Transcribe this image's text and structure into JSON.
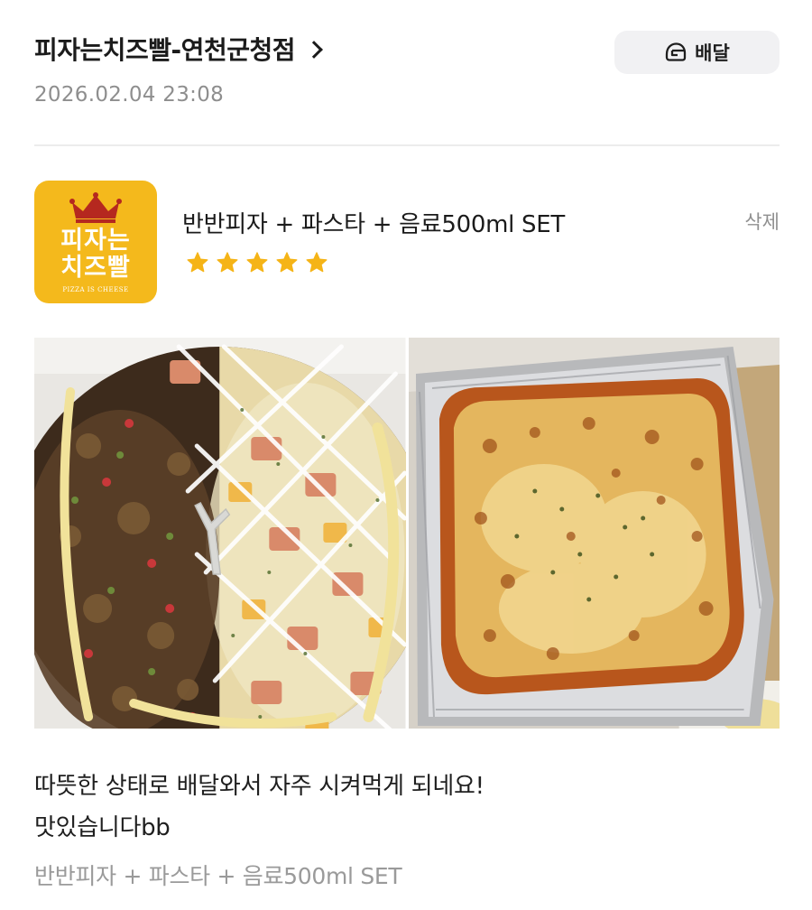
{
  "store": {
    "name": "피자는치즈빨-연천군청점",
    "timestamp": "2026.02.04 23:08"
  },
  "delivery_button": {
    "label": "배달",
    "icon": "helmet-icon"
  },
  "menu": {
    "logo": {
      "line1": "피자는",
      "line2": "치즈빨",
      "sub": "PIZZA IS CHEESE"
    },
    "title": "반반피자 + 파스타 + 음료500ml SET",
    "delete_label": "삭제",
    "rating": 5,
    "star_color": "#f5b417"
  },
  "photos": [
    {
      "name": "half-half-pizza-photo"
    },
    {
      "name": "baked-pasta-photo"
    }
  ],
  "review": {
    "line1": "따뜻한 상태로 배달와서 자주 시켜먹게 되네요!",
    "line2": "맛있습니다bb"
  },
  "ordered_item": "반반피자 + 파스타 + 음료500ml SET",
  "colors": {
    "logo_bg": "#f4b91c",
    "crown": "#b5281f",
    "muted_text": "#8e8e8e"
  }
}
